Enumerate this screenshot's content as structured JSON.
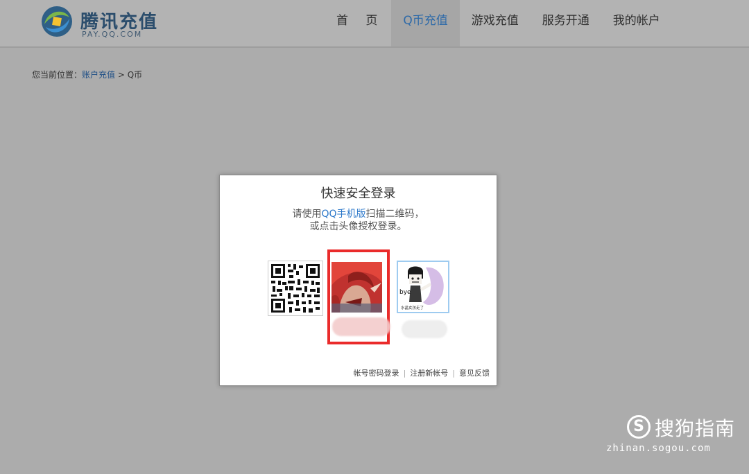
{
  "header": {
    "logo_title": "腾讯充值",
    "logo_sub": "PAY.QQ.COM",
    "nav": [
      {
        "label": "首 页",
        "active": false
      },
      {
        "label": "Q币充值",
        "active": true
      },
      {
        "label": "游戏充值",
        "active": false
      },
      {
        "label": "服务开通",
        "active": false
      },
      {
        "label": "我的帐户",
        "active": false
      }
    ]
  },
  "breadcrumb": {
    "prefix": "您当前位置：",
    "link": "账户充值",
    "separator": " > ",
    "current": "Q币"
  },
  "login_dialog": {
    "title": "快速安全登录",
    "desc_before": "请使用",
    "desc_link": "QQ手机版",
    "desc_after": "扫描二维码，",
    "desc_line2": "或点击头像授权登录。",
    "avatar2_caption": "bye",
    "avatar2_subcaption": "水晶女孩走了",
    "footer": {
      "password_login": "帐号密码登录",
      "register": "注册新帐号",
      "feedback": "意见反馈",
      "separator": "|"
    },
    "highlight_color": "#ea2b2b"
  },
  "watermark": {
    "text": "搜狗指南",
    "url": "zhinan.sogou.com",
    "symbol": "S"
  },
  "colors": {
    "overlay_bg": "#acacac",
    "link_blue": "#2b77c9",
    "active_nav": "#2e6aa8"
  }
}
